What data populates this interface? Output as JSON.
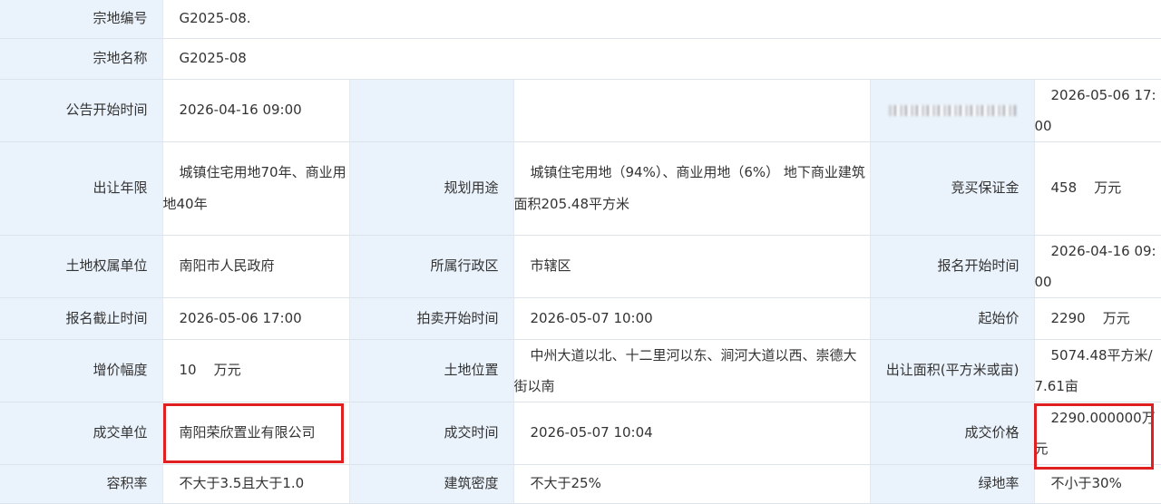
{
  "rows": {
    "parcel_no": {
      "label": "宗地编号",
      "value": "G2025-08."
    },
    "parcel_name": {
      "label": "宗地名称",
      "value": "G2025-08"
    },
    "notice_start": {
      "label": "公告开始时间",
      "value": "2026-04-16 09:00",
      "end_value": "2026-05-06 17:00"
    },
    "term": {
      "label": "出让年限",
      "value": "城镇住宅用地70年、商业用地40年"
    },
    "planned_use": {
      "label": "规划用途",
      "value": "城镇住宅用地（94%）、商业用地（6%） 地下商业建筑面积205.48平方米"
    },
    "deposit": {
      "label": "竞买保证金",
      "value": "458",
      "unit": "万元"
    },
    "owner": {
      "label": "土地权属单位",
      "value": "南阳市人民政府"
    },
    "district": {
      "label": "所属行政区",
      "value": "市辖区"
    },
    "reg_start": {
      "label": "报名开始时间",
      "value": "2026-04-16 09:00"
    },
    "reg_end": {
      "label": "报名截止时间",
      "value": "2026-05-06 17:00"
    },
    "auction_start": {
      "label": "拍卖开始时间",
      "value": "2026-05-07 10:00"
    },
    "start_price": {
      "label": "起始价",
      "value": "2290",
      "unit": "万元"
    },
    "increment": {
      "label": "增价幅度",
      "value": "10",
      "unit": "万元"
    },
    "location": {
      "label": "土地位置",
      "value": "中州大道以北、十二里河以东、涧河大道以西、崇德大街以南"
    },
    "area": {
      "label": "出让面积(平方米或亩)",
      "value": "5074.48平方米/7.61亩"
    },
    "winner": {
      "label": "成交单位",
      "value": "南阳荣欣置业有限公司"
    },
    "deal_time": {
      "label": "成交时间",
      "value": "2026-05-07 10:04"
    },
    "deal_price": {
      "label": "成交价格",
      "value": "2290.000000万元"
    },
    "far": {
      "label": "容积率",
      "value": "不大于3.5且大于1.0"
    },
    "density": {
      "label": "建筑密度",
      "value": "不大于25%"
    },
    "green": {
      "label": "绿地率",
      "value": "不小于30%"
    }
  },
  "colors": {
    "label_bg": "#eaf2fb",
    "highlight": "#e02020"
  }
}
